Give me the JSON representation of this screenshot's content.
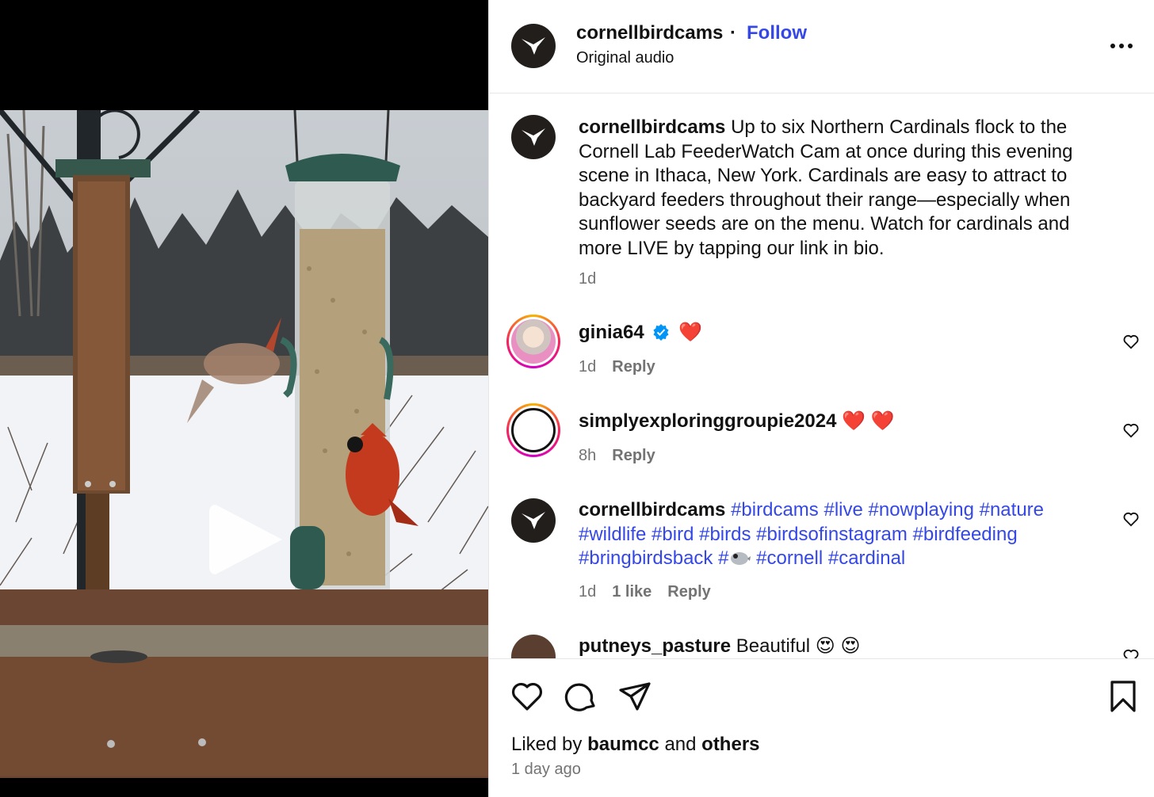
{
  "post": {
    "author": "cornellbirdcams",
    "follow_label": "Follow",
    "audio": "Original audio",
    "caption": {
      "username": "cornellbirdcams",
      "text": "Up to six Northern Cardinals flock to the Cornell Lab FeederWatch Cam at once during this evening scene in Ithaca, New York. Cardinals are easy to attract to backyard feeders throughout their range—especially when sunflower seeds are on the menu. Watch for cardinals and more LIVE by tapping our link in bio.",
      "time": "1d"
    }
  },
  "comments": [
    {
      "username": "ginia64",
      "verified": true,
      "text": "❤️",
      "time": "1d",
      "reply_label": "Reply"
    },
    {
      "username": "simplyexploringgroupie2024",
      "text": "❤️ ❤️",
      "time": "8h",
      "reply_label": "Reply"
    },
    {
      "username": "cornellbirdcams",
      "hashtags": [
        "#birdcams",
        "#live",
        "#nowplaying",
        "#nature",
        "#wildlife",
        "#bird",
        "#birds",
        "#birdsofinstagram",
        "#birdfeeding",
        "#bringbirdsback",
        "#",
        "#cornell",
        "#cardinal"
      ],
      "time": "1d",
      "likes_label": "1 like",
      "reply_label": "Reply"
    },
    {
      "username": "putneys_pasture",
      "text": "Beautiful 😍 😍"
    }
  ],
  "footer": {
    "liked_by_prefix": "Liked by",
    "liked_by_user": "baumcc",
    "liked_by_and": "and",
    "liked_by_others": "others",
    "date": "1 day ago"
  },
  "icons": {
    "like": "heart-icon",
    "comment": "comment-icon",
    "share": "share-icon",
    "save": "bookmark-icon",
    "more": "more-options-icon",
    "play": "play-icon",
    "verified": "verified-badge-icon",
    "bird_emoji": "bird-emoji-icon"
  },
  "colors": {
    "link": "#3548e6",
    "muted": "#737373",
    "heart": "#e4252d",
    "verified": "#0095f6"
  }
}
